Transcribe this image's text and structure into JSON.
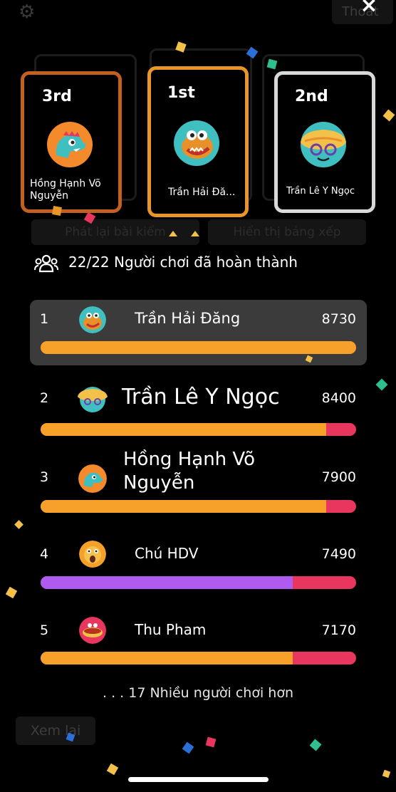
{
  "header": {
    "exit_label": "Thoát"
  },
  "podium": {
    "first": {
      "rank": "1st",
      "name": "Trần Hải Đă..."
    },
    "second": {
      "rank": "2nd",
      "name": "Trần Lê Y Ngọc"
    },
    "third": {
      "rank": "3rd",
      "name_line1": "Hồng Hạnh Võ",
      "name_line2": "Nguyễn"
    }
  },
  "ghost_buttons": {
    "replay": "Phát lại bài kiểm",
    "show_ranking": "Hiển thị bảng xếp"
  },
  "players_summary": "22/22 Người chơi đã hoàn thành",
  "leaderboard": [
    {
      "rank": "1",
      "name": "Trần Hải Đăng",
      "score": "8730",
      "progress": 1.0,
      "bar_color": "#f7a12a"
    },
    {
      "rank": "2",
      "name": "Trần Lê Y Ngọc",
      "score": "8400",
      "progress": 0.905,
      "bar_color": "#f7a12a"
    },
    {
      "rank": "3",
      "name_line1": "Hồng Hạnh Võ",
      "name_line2": "Nguyễn",
      "score": "7900",
      "progress": 0.905,
      "bar_color": "#f7a12a"
    },
    {
      "rank": "4",
      "name": "Chú HDV",
      "score": "7490",
      "progress": 0.8,
      "bar_color": "#b05bef"
    },
    {
      "rank": "5",
      "name": "Thu Pham",
      "score": "7170",
      "progress": 0.8,
      "bar_color": "#f7a12a"
    }
  ],
  "more_players": ". . . 17 Nhiều người chơi hơn",
  "review_label": "Xem lại",
  "colors": {
    "accent_orange": "#f7a12a",
    "bar_red": "#e8365f",
    "purple": "#b05bef",
    "card_first": "#e9952a",
    "card_second": "#d9d9d9",
    "card_third": "#c2611f"
  }
}
